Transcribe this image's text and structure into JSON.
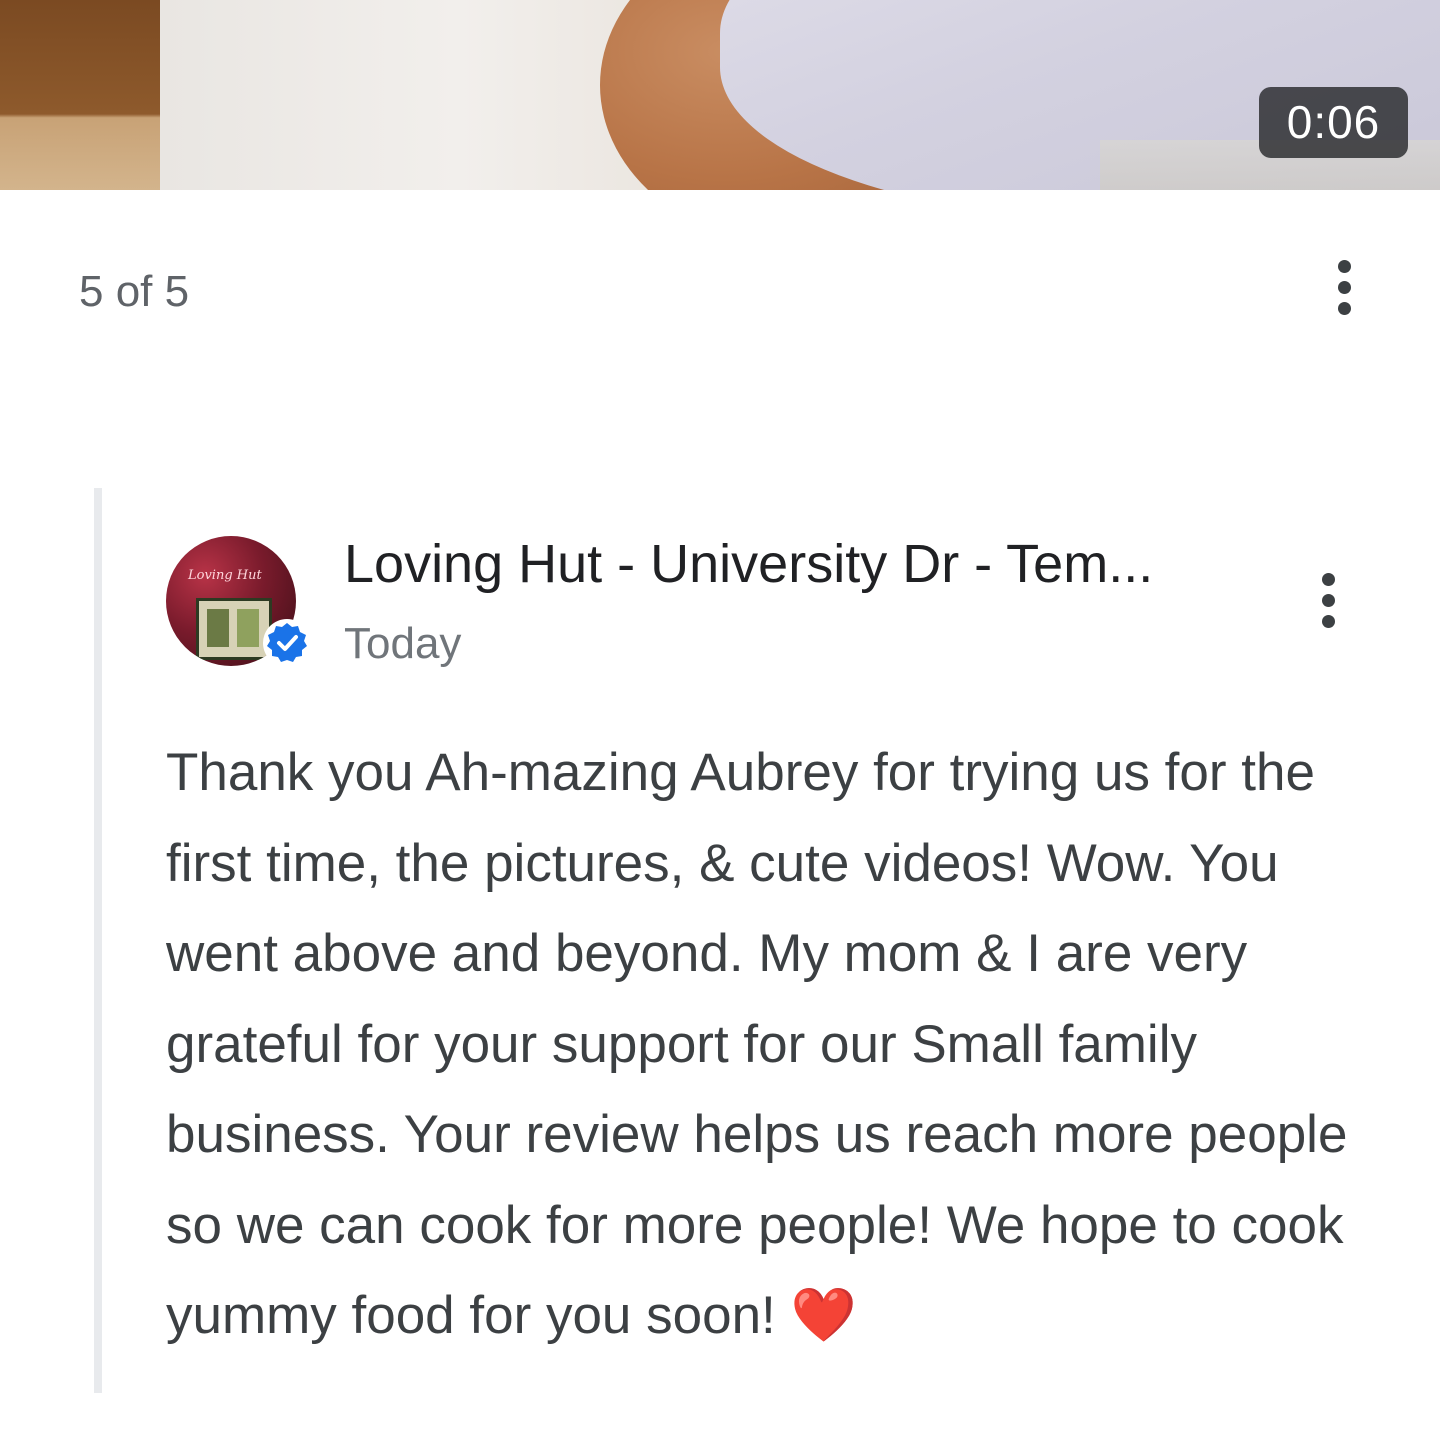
{
  "media": {
    "duration": "0:06"
  },
  "counter": {
    "label": "5 of 5"
  },
  "reply": {
    "owner_name": "Loving Hut - University Dr - Tem...",
    "avatar_sign": "Loving Hut",
    "date": "Today",
    "text": "Thank you Ah-mazing Aubrey for trying us for the first time, the pictures, & cute videos! Wow. You went above and beyond. My mom & I are very grateful for your support for our Small family business. Your review helps us reach more people so we can cook for more people! We hope to cook yummy food for you soon! ❤️"
  },
  "icons": {
    "more": "more-vert-icon",
    "verified": "verified-badge-icon"
  },
  "colors": {
    "verified_blue": "#1a73e8",
    "heart_red": "#e0242b"
  }
}
